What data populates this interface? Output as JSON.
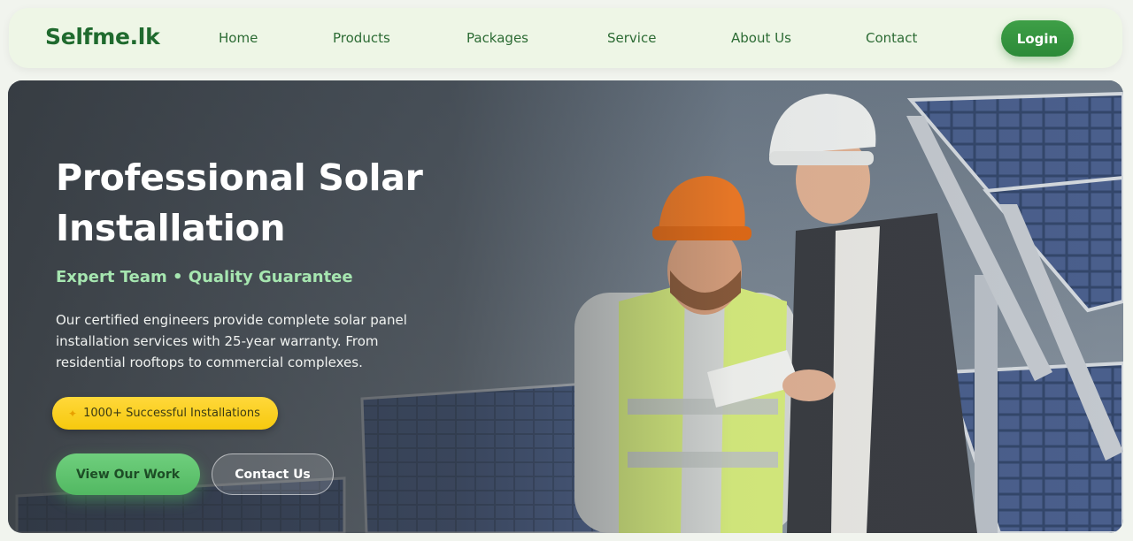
{
  "nav": {
    "logo": "Selfme.lk",
    "links": [
      "Home",
      "Products",
      "Packages",
      "Service",
      "About Us",
      "Contact"
    ],
    "login_label": "Login"
  },
  "hero": {
    "title_line1": "Professional Solar",
    "title_line2": "Installation",
    "subtitle": "Expert Team • Quality Guarantee",
    "description": "Our certified engineers provide complete solar panel installation services with 25-year warranty. From residential rooftops to commercial complexes.",
    "badge": {
      "icon": "sparkle-icon",
      "text": "1000+ Successful Installations"
    },
    "primary_button": "View Our Work",
    "secondary_button": "Contact Us"
  },
  "colors": {
    "brand_green": "#1f6a2e",
    "accent_green": "#52b862",
    "badge_yellow": "#f6c90e",
    "subtitle_mint": "#a6e6b0"
  }
}
